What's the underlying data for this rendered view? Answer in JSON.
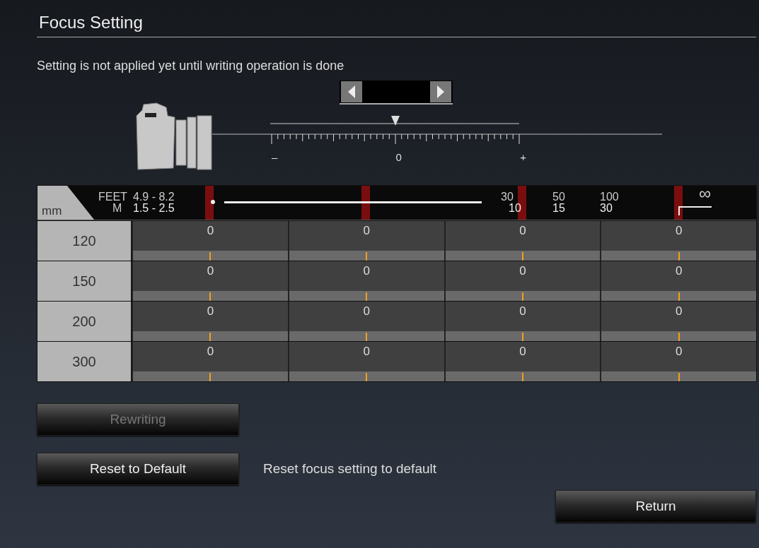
{
  "title": "Focus Setting",
  "notice": "Setting is not applied yet until writing operation is done",
  "adjuster": {
    "minus": "–",
    "zero": "0",
    "plus": "+"
  },
  "table": {
    "corner": "mm",
    "feet_label": "FEET",
    "m_label": "M",
    "scale": [
      {
        "feet": "4.9 - 8.2",
        "m": "1.5 - 2.5"
      },
      {
        "feet": "30",
        "m": "10"
      },
      {
        "feet": "50",
        "m": "15"
      },
      {
        "feet": "100",
        "m": "30"
      },
      {
        "feet": "∞"
      }
    ],
    "rows": [
      {
        "focal": "120",
        "cells": [
          {
            "value": "0",
            "level": 0.5
          },
          {
            "value": "0",
            "level": 0.5
          },
          {
            "value": "0",
            "level": 0.5
          },
          {
            "value": "0",
            "level": 0.5
          }
        ]
      },
      {
        "focal": "150",
        "cells": [
          {
            "value": "0",
            "level": 0.5
          },
          {
            "value": "0",
            "level": 0.5
          },
          {
            "value": "0",
            "level": 0.5
          },
          {
            "value": "0",
            "level": 0.5
          }
        ]
      },
      {
        "focal": "200",
        "cells": [
          {
            "value": "0",
            "level": 0.5
          },
          {
            "value": "0",
            "level": 0.5
          },
          {
            "value": "0",
            "level": 0.5
          },
          {
            "value": "0",
            "level": 0.5
          }
        ]
      },
      {
        "focal": "300",
        "cells": [
          {
            "value": "0",
            "level": 0.5
          },
          {
            "value": "0",
            "level": 0.5
          },
          {
            "value": "0",
            "level": 0.5
          },
          {
            "value": "0",
            "level": 0.5
          }
        ]
      }
    ]
  },
  "buttons": [
    {
      "label": "Rewriting",
      "disabled": true
    },
    {
      "label": "Reset to Default",
      "disabled": false,
      "description": "Reset focus setting to default"
    }
  ],
  "return_button": "Return"
}
